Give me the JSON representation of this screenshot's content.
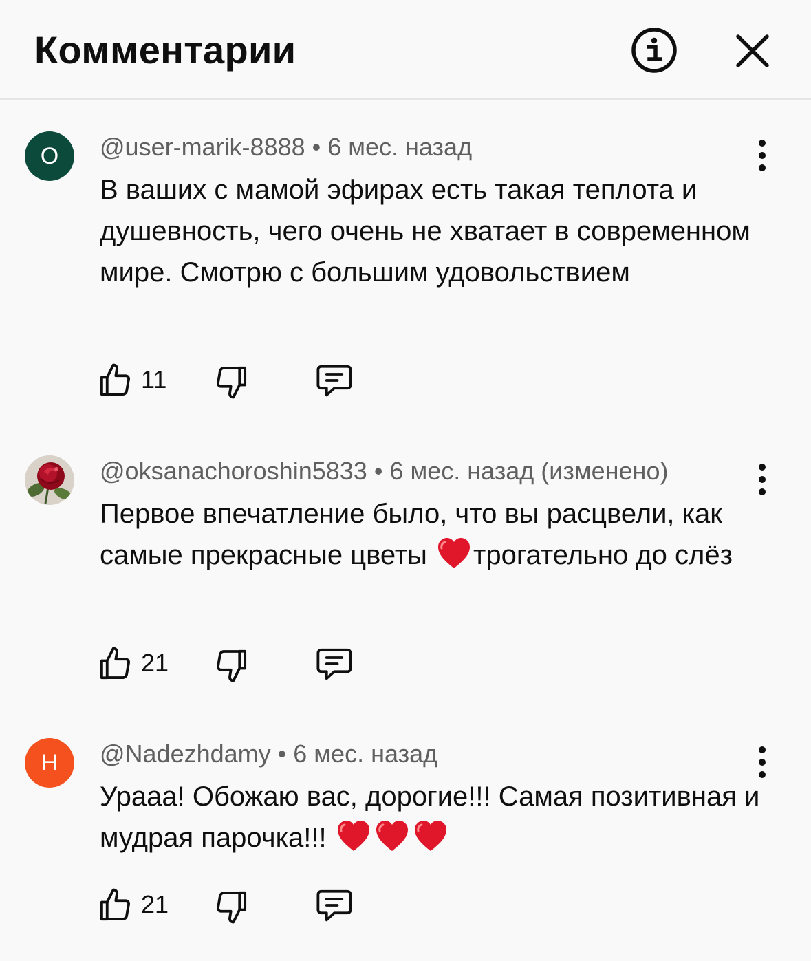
{
  "header": {
    "title": "Комментарии",
    "info_icon": "info-icon",
    "close_icon": "close-icon"
  },
  "comments": [
    {
      "avatar_letter": "О",
      "avatar_color": "#0c4a3c",
      "author": "@user-marik-8888",
      "separator": "•",
      "time": "6 мес. назад",
      "edited": "",
      "text": "В ваших с мамой эфирах есть такая теплота и душевность, чего очень не хватает в современном мире. Смотрю с большим удовольствием",
      "likes": "11"
    },
    {
      "avatar_letter": "",
      "avatar_color": "#d8d0c8",
      "author": "@oksanachoroshin5833",
      "separator": "•",
      "time": "6 мес. назад",
      "edited": "(изменено)",
      "text_before": "Первое впечатление было, что вы расцвели, как самые прекрасные цветы",
      "text_after": "трогательно до слёз",
      "likes": "21"
    },
    {
      "avatar_letter": "Н",
      "avatar_color": "#f4511e",
      "author": "@Nadezhdamy",
      "separator": "•",
      "time": "6 мес. назад",
      "edited": "",
      "text": "Урааа! Обожаю вас, дорогие!!! Самая позитивная и мудрая парочка!!!",
      "likes": "21"
    }
  ],
  "icons": {
    "like": "thumbs-up-icon",
    "dislike": "thumbs-down-icon",
    "reply": "reply-icon",
    "more": "more-vertical-icon",
    "heart": "red-heart-emoji"
  },
  "colors": {
    "background": "#f9f9f9",
    "text": "#0f0f0f",
    "secondary_text": "#606060",
    "divider": "#e5e5e5",
    "heart": "#e0162b"
  }
}
